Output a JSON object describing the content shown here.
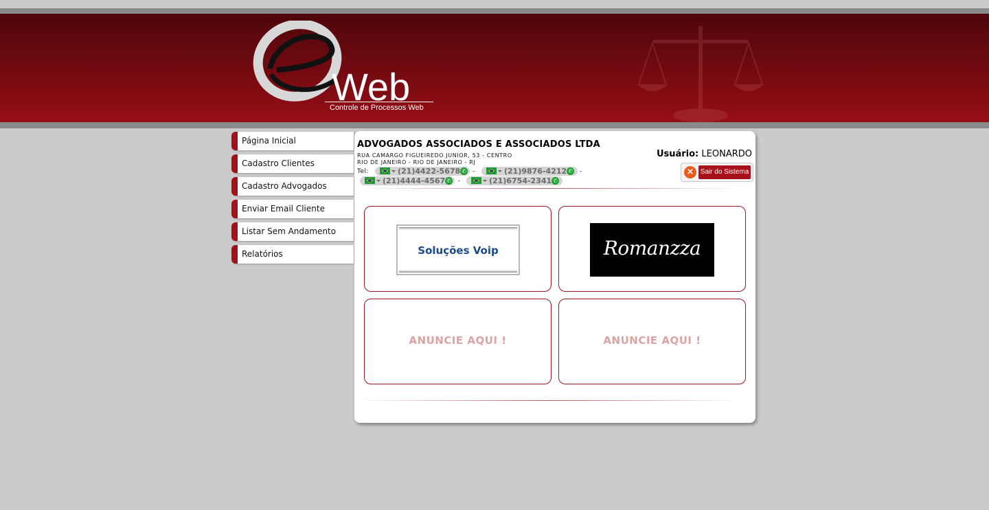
{
  "header": {
    "logo_text": "Web",
    "logo_subtitle": "Controle de Processos Web"
  },
  "sidebar": {
    "items": [
      {
        "label": "Página Inicial"
      },
      {
        "label": "Cadastro Clientes"
      },
      {
        "label": "Cadastro Advogados"
      },
      {
        "label": "Enviar Email Cliente"
      },
      {
        "label": "Listar Sem Andamento"
      },
      {
        "label": "Relatórios"
      }
    ]
  },
  "company": {
    "name": "ADVOGADOS ASSOCIADOS E ASSOCIADOS LTDA",
    "address_line1": "RUA CAMARGO FIGUEIREDO JUNIOR, 53 - CENTRO",
    "address_line2": "RIO DE JANEIRO - RIO DE JANEIRO - RJ",
    "tel_label": "Tel:",
    "phones": [
      "(21)4422-5678",
      "(21)9876-4212",
      "(21)4444-4567",
      "(21)6754-2341"
    ],
    "separator": "-"
  },
  "user": {
    "label": "Usuário:",
    "name": "LEONARDO"
  },
  "logout": {
    "label": "Sair do Sistema"
  },
  "ads": [
    {
      "text": "Soluções Voip"
    },
    {
      "text": "Romanzza"
    },
    {
      "text": "ANUNCIE AQUI !"
    },
    {
      "text": "ANUNCIE AQUI !"
    }
  ],
  "colors": {
    "brand_red": "#a50f18",
    "banner_dark": "#4e060a",
    "page_bg": "#cbcbcb"
  }
}
